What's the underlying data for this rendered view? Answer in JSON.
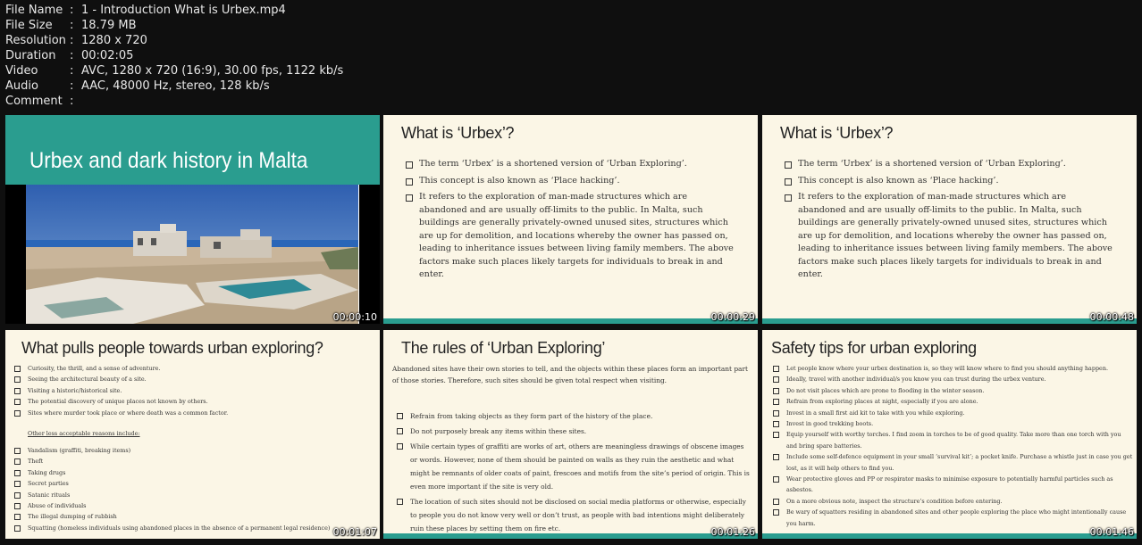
{
  "file_info": [
    {
      "key": "File Name",
      "value": "1 - Introduction What is Urbex.mp4"
    },
    {
      "key": "File Size",
      "value": "18.79 MB"
    },
    {
      "key": "Resolution",
      "value": "1280 x 720"
    },
    {
      "key": "Duration",
      "value": "00:02:05"
    },
    {
      "key": "Video",
      "value": "AVC, 1280 x 720 (16:9), 30.00 fps, 1122 kb/s"
    },
    {
      "key": "Audio",
      "value": "AAC, 48000 Hz, stereo, 128 kb/s"
    },
    {
      "key": "Comment",
      "value": ""
    }
  ],
  "separator": ":",
  "thumbs": [
    {
      "timestamp": "00:00:10",
      "title": "Urbex and dark history in Malta"
    },
    {
      "timestamp": "00:00:29",
      "title": "What is ‘Urbex’?",
      "bullets": [
        "The term ‘Urbex’ is a shortened version of ‘Urban Exploring’.",
        "This concept is also known as ‘Place hacking’.",
        "It refers to the exploration of man-made structures which are abandoned and are usually off-limits to the public. In Malta, such buildings are generally privately-owned unused sites, structures which are up for demolition, and locations whereby the owner has passed on, leading to inheritance issues between living family members. The above factors make such places likely targets for individuals to break in and enter."
      ]
    },
    {
      "timestamp": "00:00:48",
      "title": "What is ‘Urbex’?",
      "bullets": [
        "The term ‘Urbex’ is a shortened version of ‘Urban Exploring’.",
        "This concept is also known as ‘Place hacking’.",
        "It refers to the exploration of man-made structures which are abandoned and are usually off-limits to the public. In Malta, such buildings are generally privately-owned unused sites, structures which are up for demolition, and locations whereby the owner has passed on, leading to inheritance issues between living family members. The above factors make such places likely targets for individuals to break in and enter."
      ]
    },
    {
      "timestamp": "00:01:07",
      "title": "What pulls people towards urban exploring?",
      "bullets_a": [
        "Curiosity, the thrill, and a sense of adventure.",
        "Seeing the architectural beauty of a site.",
        "Visiting a historic/historical site.",
        "The potential discovery of unique places not known by others.",
        "Sites where murder took place or where death was a common factor."
      ],
      "subheading": "Other less acceptable reasons include:",
      "bullets_b": [
        "Vandalism (graffiti, breaking items)",
        "Theft",
        "Taking drugs",
        "Secret parties",
        "Satanic rituals",
        "Abuse of individuals",
        "The illegal dumping of rubbish",
        "Squatting (homeless individuals using abandoned places in the absence of a permanent legal residence)"
      ]
    },
    {
      "timestamp": "00:01:26",
      "title": "The rules of ‘Urban Exploring’",
      "intro": "Abandoned sites have their own stories to tell, and the objects within these places form an important part of those stories. Therefore, such sites should be given total respect when visiting.",
      "bullets": [
        "Refrain from taking objects as they form part of the history of the place.",
        "Do not purposely break any items within these sites.",
        "While certain types of graffiti are works of art, others are meaningless drawings of obscene images or words. However, none of them should be painted on walls as they ruin the aesthetic and what might be remnants of older coats of paint, frescoes and motifs from the site’s period of origin. This is even more important if the site is very old.",
        "The location of such sites should not be disclosed on social media platforms or otherwise, especially to people you do not know very well or don’t trust, as people with bad intentions might deliberately ruin these places by setting them on fire etc."
      ]
    },
    {
      "timestamp": "00:01:46",
      "title": "Safety tips for urban exploring",
      "bullets": [
        "Let people know where your urbex destination is, so they will know where to find you should anything happen.",
        "Ideally, travel with another individual/s you know you can trust during the urbex venture.",
        "Do not visit places which are prone to flooding in the winter season.",
        "Refrain from exploring places at night, especially if you are alone.",
        "Invest in a small first aid kit to take with you while exploring.",
        "Invest in good trekking boots.",
        "Equip yourself with worthy torches. I find zoom in torches to be of good quality. Take more than one torch with you and bring spare batteries.",
        "Include some self-defence equipment in your small ‘survival kit’; a pocket knife. Purchase a whistle just in case you get lost, as it will help others to find you.",
        "Wear protective gloves and PP or respirator masks to minimise exposure to potentially harmful particles such as asbestos.",
        "On a more obvious note, inspect the structure’s condition before entering.",
        "Be wary of squatters residing in abandoned sites and other people exploring the place who might intentionally cause you harm."
      ]
    }
  ]
}
